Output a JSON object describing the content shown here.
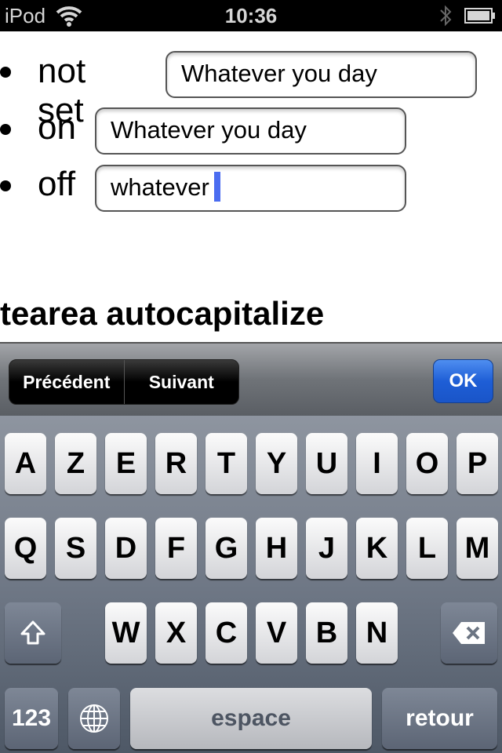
{
  "status_bar": {
    "carrier": "iPod",
    "time": "10:36",
    "icons": [
      "wifi-icon",
      "bluetooth-icon",
      "battery-icon"
    ]
  },
  "page": {
    "items": [
      {
        "label": "not set",
        "value": "Whatever you day"
      },
      {
        "label": "on",
        "value": "Whatever you day"
      },
      {
        "label": "off",
        "value": "whatever",
        "focused": true
      }
    ],
    "heading": "tearea autocapitalize"
  },
  "accessory_bar": {
    "previous_label": "Précédent",
    "next_label": "Suivant",
    "done_label": "OK",
    "done_color": "#1e5ed6"
  },
  "keyboard": {
    "row1": [
      "A",
      "Z",
      "E",
      "R",
      "T",
      "Y",
      "U",
      "I",
      "O",
      "P"
    ],
    "row2": [
      "Q",
      "S",
      "D",
      "F",
      "G",
      "H",
      "J",
      "K",
      "L",
      "M"
    ],
    "row3": [
      "W",
      "X",
      "C",
      "V",
      "B",
      "N"
    ],
    "shift_icon": "shift-arrow-icon",
    "delete_icon": "backspace-icon",
    "numbers_label": "123",
    "globe_icon": "globe-icon",
    "space_label": "espace",
    "return_label": "retour"
  }
}
